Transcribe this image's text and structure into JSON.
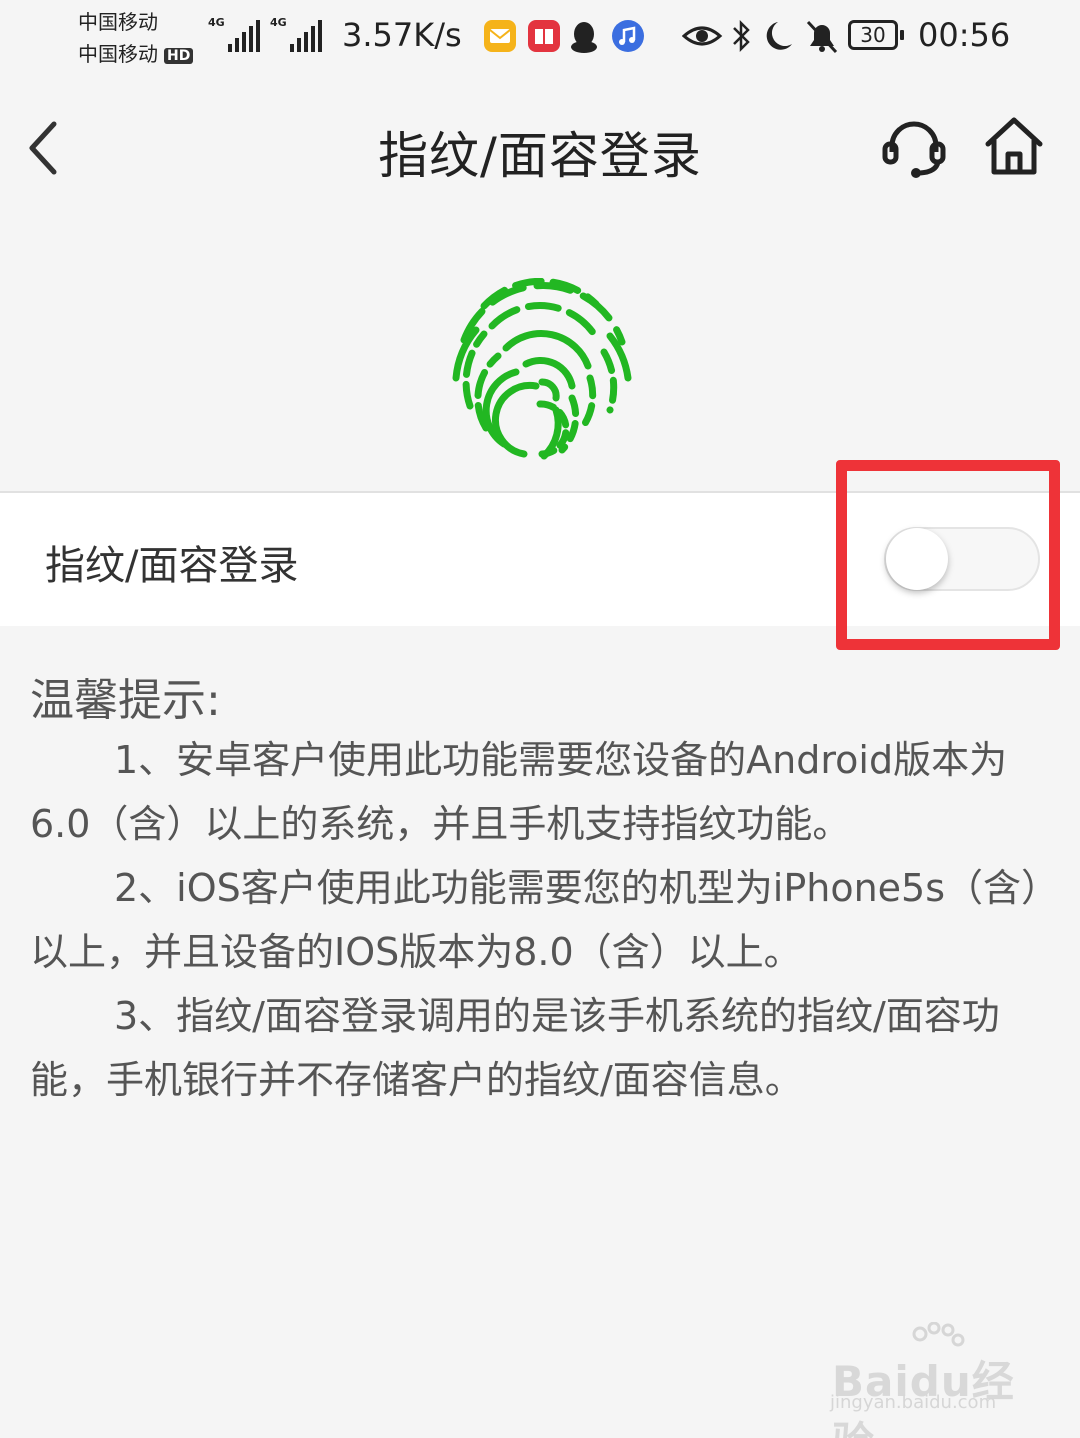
{
  "status_bar": {
    "carrier1": "中国移动",
    "carrier2": "中国移动",
    "hd_badge": "HD",
    "network1": "4G",
    "network2": "4G",
    "net_speed": "3.57K/s",
    "app_icons": [
      "mail-app-icon",
      "book-app-icon",
      "qq-icon",
      "music-app-icon"
    ],
    "system_icons": [
      "eye-icon",
      "bluetooth-icon",
      "moon-icon",
      "bell-muted-icon"
    ],
    "battery": "30",
    "time": "00:56"
  },
  "nav": {
    "title": "指纹/面容登录",
    "back_icon": "chevron-left-icon",
    "service_icon": "headset-icon",
    "home_icon": "home-icon"
  },
  "hero": {
    "icon": "fingerprint-icon",
    "color": "#22b722"
  },
  "setting": {
    "label": "指纹/面容登录",
    "enabled": false
  },
  "tips": {
    "title": "温馨提示:",
    "items": [
      "1、安卓客户使用此功能需要您设备的Android版本为6.0（含）以上的系统，并且手机支持指纹功能。",
      "2、iOS客户使用此功能需要您的机型为iPhone5s（含）以上，并且设备的IOS版本为8.0（含）以上。",
      "3、指纹/面容登录调用的是该手机系统的指纹/面容功能，手机银行并不存储客户的指纹/面容信息。"
    ]
  },
  "watermark": {
    "logo": "Baidu经验",
    "url": "jingyan.baidu.com"
  },
  "colors": {
    "highlight": "#ee3338",
    "background": "#f5f5f5"
  }
}
